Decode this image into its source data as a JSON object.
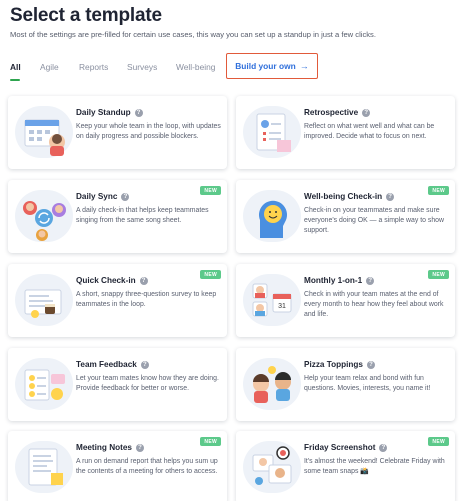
{
  "header": {
    "title": "Select a template",
    "subtitle": "Most of the settings are pre-filled for certain use cases, this way you can set up a standup in just a few clicks."
  },
  "tabs": [
    {
      "label": "All",
      "active": true
    },
    {
      "label": "Agile",
      "active": false
    },
    {
      "label": "Reports",
      "active": false
    },
    {
      "label": "Surveys",
      "active": false
    },
    {
      "label": "Well-being",
      "active": false
    }
  ],
  "build_own": {
    "label": "Build your own",
    "arrow": "→"
  },
  "templates": [
    {
      "title": "Daily Standup",
      "desc": "Keep your whole team in the loop, with updates on daily progress and possible blockers.",
      "new": false,
      "icon": "calendar-illustration"
    },
    {
      "title": "Retrospective",
      "desc": "Reflect on what went well and what can be improved. Decide what to focus on next.",
      "new": false,
      "icon": "checklist-illustration"
    },
    {
      "title": "Daily Sync",
      "desc": "A daily check-in that helps keep teammates singing from the same song sheet.",
      "new": true,
      "icon": "sync-illustration"
    },
    {
      "title": "Well-being Check-in",
      "desc": "Check-in on your teammates and make sure everyone's doing OK — a simple way to show support.",
      "new": true,
      "icon": "smiley-head-illustration"
    },
    {
      "title": "Quick Check-in",
      "desc": "A short, snappy three-question survey to keep teammates in the loop.",
      "new": true,
      "icon": "coffee-illustration"
    },
    {
      "title": "Monthly 1-on-1",
      "desc": "Check in with your team mates at the end of every month to hear how they feel about work and life.",
      "new": true,
      "icon": "monthly-calendar-illustration"
    },
    {
      "title": "Team Feedback",
      "desc": "Let your team mates know how they are doing. Provide feedback for better or worse.",
      "new": false,
      "icon": "feedback-illustration"
    },
    {
      "title": "Pizza Toppings",
      "desc": "Help your team relax and bond with fun questions. Movies, interests, you name it!",
      "new": false,
      "icon": "pizza-people-illustration"
    },
    {
      "title": "Meeting Notes",
      "desc": "A run on demand report that helps you sum up the contents of a meeting for others to access.",
      "new": true,
      "icon": "notes-illustration"
    },
    {
      "title": "Friday Screenshot",
      "desc": "It's almost the weekend! Celebrate Friday with some team snaps 📸",
      "new": true,
      "icon": "screenshot-illustration"
    }
  ],
  "badge_label": "NEW",
  "help_glyph": "?",
  "colors": {
    "accent_blue": "#2f6fdb",
    "tab_active_underline": "#2ea44f",
    "badge_green": "#5cc98a",
    "highlight_border": "#e15a3a"
  }
}
